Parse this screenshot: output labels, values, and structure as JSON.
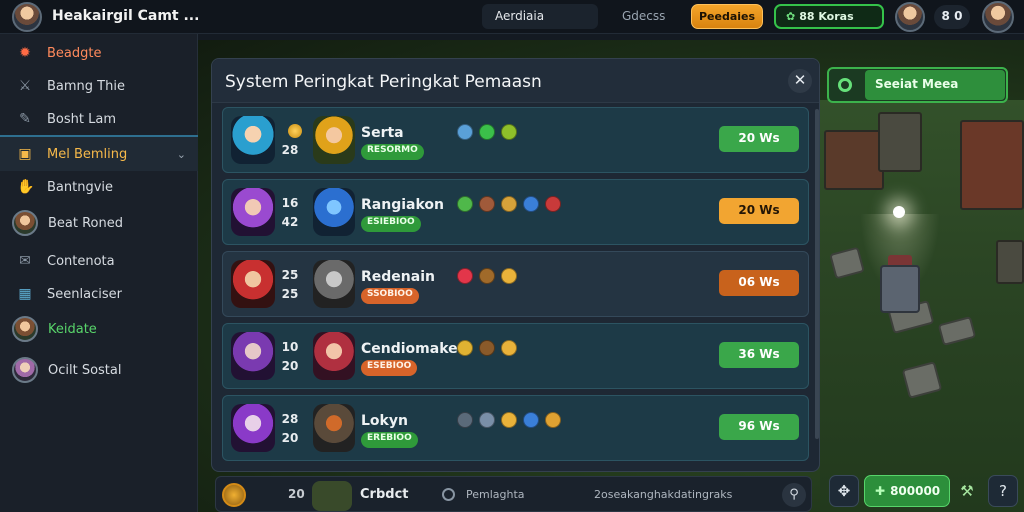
{
  "header": {
    "title": "Heakairgil Camt ...",
    "search_label": "Aerdiaia",
    "link_label": "Gdecss",
    "orange_button": "Peedaies",
    "green_button": "88 Koras",
    "count": "8 0"
  },
  "sidebar": {
    "items": [
      {
        "label": "Beadgte",
        "icon": "flame-icon"
      },
      {
        "label": "Bamng Thie",
        "icon": "swords-icon"
      },
      {
        "label": "Bosht Lam",
        "icon": "chat-icon"
      },
      {
        "label": "Mel Bemling",
        "icon": "chest-icon"
      },
      {
        "label": "Bantngvie",
        "icon": "hand-icon"
      },
      {
        "label": "Beat Roned",
        "icon": "avatar"
      },
      {
        "label": "Contenota",
        "icon": "chat-icon"
      },
      {
        "label": "Seenlaciser",
        "icon": "grid-icon"
      },
      {
        "label": "Keidate",
        "icon": "avatar"
      },
      {
        "label": "Ocilt Sostal",
        "icon": "avatar"
      }
    ]
  },
  "panel": {
    "title": "System Peringkat Peringkat Pemaasn",
    "rows": [
      {
        "level_a": "",
        "level_b": "28",
        "name": "Serta",
        "tag": "RESORMO",
        "action": "20 Ws"
      },
      {
        "level_a": "16",
        "level_b": "42",
        "name": "Rangiakon",
        "tag": "ESIEBIOO",
        "action": "20 Ws"
      },
      {
        "level_a": "25",
        "level_b": "25",
        "name": "Redenain",
        "tag": "SSOBIOO",
        "action": "06 Ws"
      },
      {
        "level_a": "10",
        "level_b": "20",
        "name": "Cendiomake",
        "tag": "ESEBIOO",
        "action": "36 Ws"
      },
      {
        "level_a": "28",
        "level_b": "20",
        "name": "Lokyn",
        "tag": "EREBIOO",
        "action": "96 Ws"
      }
    ]
  },
  "bottom_row": {
    "level": "20",
    "name": "Crbdct",
    "text1": "Pemlaghta",
    "text2": "2oseakanghakdatingraks"
  },
  "social": {
    "label": "Seeiat Meea"
  },
  "footer": {
    "money": "800000"
  },
  "colors": {
    "accent_green": "#3aa74a",
    "accent_orange": "#f2a531",
    "dark_orange": "#c8621c"
  }
}
